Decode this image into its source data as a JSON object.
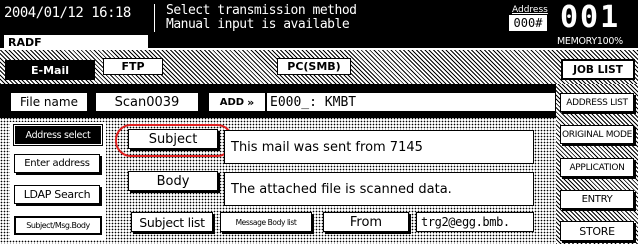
{
  "status": {
    "datetime": "2004/01/12 16:18",
    "message_line1": "Select transmission method",
    "message_line2": "Manual input is available",
    "address_label": "Address",
    "address_value": "000#",
    "counter": "001",
    "memory": "MEMORY100%",
    "mode": "RADF"
  },
  "tabs": [
    {
      "label": "E-Mail",
      "active": true
    },
    {
      "label": "FTP",
      "active": false
    },
    {
      "label": "PC(SMB)",
      "active": false
    }
  ],
  "job_list_label": "JOB LIST",
  "file_name_label": "File name",
  "file_name_value": "Scan0039",
  "add_button_label": "ADD",
  "destination_value": "E000_: KMBT",
  "left_menu": [
    "Address select",
    "Enter address",
    "LDAP Search",
    "Subject/Msg.Body"
  ],
  "subject_button_label": "Subject",
  "subject_value": "This mail was sent from 7145",
  "body_button_label": "Body",
  "body_value": "The attached file is scanned data.",
  "subject_list_label": "Subject list",
  "message_body_list_label": "Message Body list",
  "from_label": "From",
  "from_value": "trg2@egg.bmb.",
  "right_menu": [
    "ADDRESS LIST",
    "ORIGINAL MODE",
    "APPLICATION",
    "ENTRY",
    "STORE"
  ],
  "colors": {
    "highlight_oval": "#e02020",
    "panel": "#000000",
    "background": "#ffffff"
  }
}
